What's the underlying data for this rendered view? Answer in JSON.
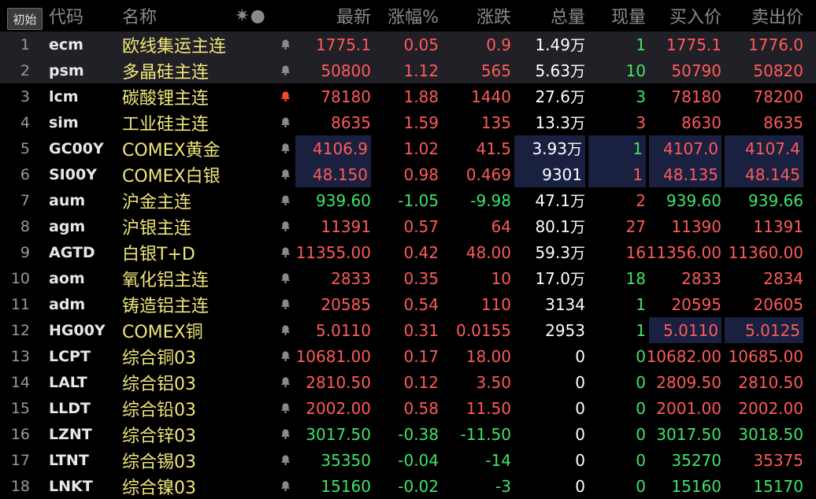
{
  "header": {
    "tab_label": "初始",
    "columns": [
      "代码",
      "名称",
      "✷●",
      "最新",
      "涨幅%",
      "涨跌",
      "总量",
      "现量",
      "买入价",
      "卖出价"
    ]
  },
  "colors": {
    "up": "#ff5a5a",
    "down": "#3ee46a",
    "name": "#f0e67a",
    "bell_active": "#ff4a2a",
    "bell": "#8a8a8a"
  },
  "rows": [
    {
      "idx": "1",
      "code": "ecm",
      "name": "欧线集运主连",
      "alert": false,
      "last": "1775.1",
      "pct": "0.05",
      "chg": "0.9",
      "vol": "1.49万",
      "cur": "1",
      "bid": "1775.1",
      "ask": "1776.0",
      "dir": "up",
      "cur_dir": "down",
      "bid_dir": "up",
      "ask_dir": "up",
      "selected": true,
      "hl": []
    },
    {
      "idx": "2",
      "code": "psm",
      "name": "多晶硅主连",
      "alert": false,
      "last": "50800",
      "pct": "1.12",
      "chg": "565",
      "vol": "5.63万",
      "cur": "10",
      "bid": "50790",
      "ask": "50820",
      "dir": "up",
      "cur_dir": "down",
      "bid_dir": "up",
      "ask_dir": "up",
      "selected": true,
      "hl": []
    },
    {
      "idx": "3",
      "code": "lcm",
      "name": "碳酸锂主连",
      "alert": true,
      "last": "78180",
      "pct": "1.88",
      "chg": "1440",
      "vol": "27.6万",
      "cur": "3",
      "bid": "78180",
      "ask": "78200",
      "dir": "up",
      "cur_dir": "down",
      "bid_dir": "up",
      "ask_dir": "up",
      "selected": false,
      "hl": []
    },
    {
      "idx": "4",
      "code": "sim",
      "name": "工业硅主连",
      "alert": false,
      "last": "8635",
      "pct": "1.59",
      "chg": "135",
      "vol": "13.3万",
      "cur": "3",
      "bid": "8630",
      "ask": "8635",
      "dir": "up",
      "cur_dir": "up",
      "bid_dir": "up",
      "ask_dir": "up",
      "selected": false,
      "hl": []
    },
    {
      "idx": "5",
      "code": "GC00Y",
      "name": "COMEX黄金",
      "alert": false,
      "last": "4106.9",
      "pct": "1.02",
      "chg": "41.5",
      "vol": "3.93万",
      "cur": "1",
      "bid": "4107.0",
      "ask": "4107.4",
      "dir": "up",
      "cur_dir": "down",
      "bid_dir": "up",
      "ask_dir": "up",
      "selected": false,
      "hl": [
        "last",
        "vol",
        "cur",
        "bid",
        "ask"
      ]
    },
    {
      "idx": "6",
      "code": "SI00Y",
      "name": "COMEX白银",
      "alert": false,
      "last": "48.150",
      "pct": "0.98",
      "chg": "0.469",
      "vol": "9301",
      "cur": "1",
      "bid": "48.135",
      "ask": "48.145",
      "dir": "up",
      "cur_dir": "up",
      "bid_dir": "up",
      "ask_dir": "up",
      "selected": false,
      "hl": [
        "last",
        "vol",
        "cur",
        "bid",
        "ask"
      ]
    },
    {
      "idx": "7",
      "code": "aum",
      "name": "沪金主连",
      "alert": false,
      "last": "939.60",
      "pct": "-1.05",
      "chg": "-9.98",
      "vol": "47.1万",
      "cur": "2",
      "bid": "939.60",
      "ask": "939.66",
      "dir": "down",
      "cur_dir": "up",
      "bid_dir": "down",
      "ask_dir": "down",
      "selected": false,
      "hl": []
    },
    {
      "idx": "8",
      "code": "agm",
      "name": "沪银主连",
      "alert": false,
      "last": "11391",
      "pct": "0.57",
      "chg": "64",
      "vol": "80.1万",
      "cur": "27",
      "bid": "11390",
      "ask": "11391",
      "dir": "up",
      "cur_dir": "up",
      "bid_dir": "up",
      "ask_dir": "up",
      "selected": false,
      "hl": []
    },
    {
      "idx": "9",
      "code": "AGTD",
      "name": "白银T+D",
      "alert": false,
      "last": "11355.00",
      "pct": "0.42",
      "chg": "48.00",
      "vol": "59.3万",
      "cur": "16",
      "bid": "11356.00",
      "ask": "11360.00",
      "dir": "up",
      "cur_dir": "up",
      "bid_dir": "up",
      "ask_dir": "up",
      "selected": false,
      "hl": []
    },
    {
      "idx": "10",
      "code": "aom",
      "name": "氧化铝主连",
      "alert": false,
      "last": "2833",
      "pct": "0.35",
      "chg": "10",
      "vol": "17.0万",
      "cur": "18",
      "bid": "2833",
      "ask": "2834",
      "dir": "up",
      "cur_dir": "down",
      "bid_dir": "up",
      "ask_dir": "up",
      "selected": false,
      "hl": []
    },
    {
      "idx": "11",
      "code": "adm",
      "name": "铸造铝主连",
      "alert": false,
      "last": "20585",
      "pct": "0.54",
      "chg": "110",
      "vol": "3134",
      "cur": "1",
      "bid": "20595",
      "ask": "20605",
      "dir": "up",
      "cur_dir": "down",
      "bid_dir": "up",
      "ask_dir": "up",
      "selected": false,
      "hl": []
    },
    {
      "idx": "12",
      "code": "HG00Y",
      "name": "COMEX铜",
      "alert": false,
      "last": "5.0110",
      "pct": "0.31",
      "chg": "0.0155",
      "vol": "2953",
      "cur": "1",
      "bid": "5.0110",
      "ask": "5.0125",
      "dir": "up",
      "cur_dir": "down",
      "bid_dir": "up",
      "ask_dir": "up",
      "selected": false,
      "hl": [
        "bid",
        "ask"
      ]
    },
    {
      "idx": "13",
      "code": "LCPT",
      "name": "综合铜03",
      "alert": false,
      "last": "10681.00",
      "pct": "0.17",
      "chg": "18.00",
      "vol": "0",
      "cur": "0",
      "bid": "10682.00",
      "ask": "10685.00",
      "dir": "up",
      "cur_dir": "down",
      "bid_dir": "up",
      "ask_dir": "up",
      "selected": false,
      "hl": []
    },
    {
      "idx": "14",
      "code": "LALT",
      "name": "综合铝03",
      "alert": false,
      "last": "2810.50",
      "pct": "0.12",
      "chg": "3.50",
      "vol": "0",
      "cur": "0",
      "bid": "2809.50",
      "ask": "2810.50",
      "dir": "up",
      "cur_dir": "up",
      "bid_dir": "up",
      "ask_dir": "up",
      "selected": false,
      "hl": []
    },
    {
      "idx": "15",
      "code": "LLDT",
      "name": "综合铅03",
      "alert": false,
      "last": "2002.00",
      "pct": "0.58",
      "chg": "11.50",
      "vol": "0",
      "cur": "0",
      "bid": "2001.00",
      "ask": "2002.00",
      "dir": "up",
      "cur_dir": "up",
      "bid_dir": "up",
      "ask_dir": "up",
      "selected": false,
      "hl": []
    },
    {
      "idx": "16",
      "code": "LZNT",
      "name": "综合锌03",
      "alert": false,
      "last": "3017.50",
      "pct": "-0.38",
      "chg": "-11.50",
      "vol": "0",
      "cur": "0",
      "bid": "3017.50",
      "ask": "3018.50",
      "dir": "down",
      "cur_dir": "down",
      "bid_dir": "down",
      "ask_dir": "down",
      "selected": false,
      "hl": []
    },
    {
      "idx": "17",
      "code": "LTNT",
      "name": "综合锡03",
      "alert": false,
      "last": "35350",
      "pct": "-0.04",
      "chg": "-14",
      "vol": "0",
      "cur": "0",
      "bid": "35270",
      "ask": "35375",
      "dir": "down",
      "cur_dir": "up",
      "bid_dir": "down",
      "ask_dir": "up",
      "selected": false,
      "hl": []
    },
    {
      "idx": "18",
      "code": "LNKT",
      "name": "综合镍03",
      "alert": false,
      "last": "15160",
      "pct": "-0.02",
      "chg": "-3",
      "vol": "0",
      "cur": "0",
      "bid": "15160",
      "ask": "15170",
      "dir": "down",
      "cur_dir": "down",
      "bid_dir": "down",
      "ask_dir": "down",
      "selected": false,
      "hl": []
    }
  ]
}
